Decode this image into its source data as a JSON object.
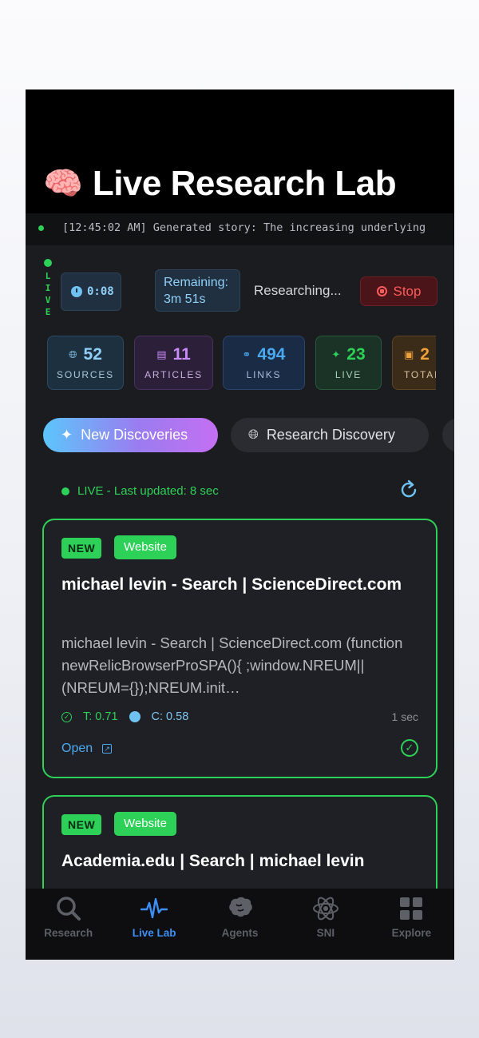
{
  "header": {
    "emoji": "🧠",
    "title": "Live Research Lab"
  },
  "ticker": {
    "text": "[12:45:02 AM] Generated story: The increasing underlying"
  },
  "live_indicator": {
    "letters": "LIVE"
  },
  "timer": {
    "value": "0:08"
  },
  "remaining": {
    "text": "Remaining: 3m 51s"
  },
  "status": {
    "text": "Researching..."
  },
  "stop_button": {
    "label": "Stop"
  },
  "stats": [
    {
      "icon": "globe-icon",
      "value": "52",
      "label": "SOURCES",
      "color": "#8fd0f8"
    },
    {
      "icon": "document-icon",
      "value": "11",
      "label": "ARTICLES",
      "color": "#c98bf5"
    },
    {
      "icon": "link-icon",
      "value": "494",
      "label": "LINKS",
      "color": "#4aa9ef"
    },
    {
      "icon": "sparkle-icon",
      "value": "23",
      "label": "LIVE",
      "color": "#2ed158"
    },
    {
      "icon": "archive-icon",
      "value": "2",
      "label": "TOTAL",
      "color": "#f0a13a"
    }
  ],
  "filters": {
    "new_discoveries": {
      "icon": "sparkle-icon",
      "label": "New Discoveries"
    },
    "research_discovery": {
      "icon": "globe-icon",
      "label": "Research Discovery"
    }
  },
  "live_status": {
    "text": "LIVE - Last updated: 8 sec"
  },
  "cards": [
    {
      "badge_new": "NEW",
      "badge_type": "Website",
      "title": "michael levin - Search | ScienceDirect.com",
      "description": "michael levin - Search | ScienceDirect.com (function newRelicBrowserProSPA(){ ;window.NREUM||(NREUM={});NREUM.init…",
      "t_score": "T: 0.71",
      "c_score": "C: 0.58",
      "time_ago": "1 sec",
      "open_label": "Open"
    },
    {
      "badge_new": "NEW",
      "badge_type": "Website",
      "title": "Academia.edu | Search | michael levin"
    }
  ],
  "tabs": [
    {
      "label": "Research",
      "icon": "search-icon"
    },
    {
      "label": "Live Lab",
      "icon": "pulse-icon",
      "active": true
    },
    {
      "label": "Agents",
      "icon": "brain-icon"
    },
    {
      "label": "SNI",
      "icon": "atom-icon"
    },
    {
      "label": "Explore",
      "icon": "grid-icon"
    }
  ],
  "colors": {
    "accent_green": "#2ed158",
    "accent_blue": "#3b8ff6",
    "stop_red": "#ff5c5c"
  }
}
